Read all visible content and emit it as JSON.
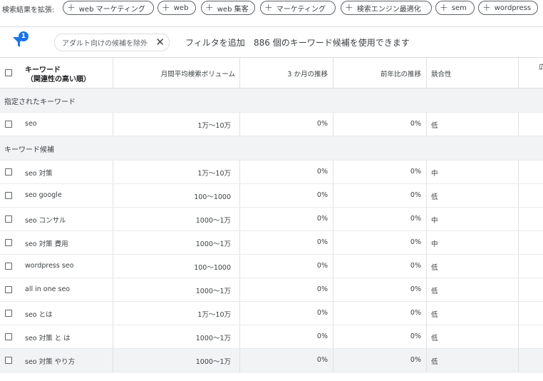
{
  "expand": {
    "label": "検索結果を拡張:",
    "chips": [
      "web マーケティング",
      "web",
      "web 集客",
      "マーケティング",
      "検索エンジン最適化",
      "sem",
      "wordpress"
    ]
  },
  "filter": {
    "badge": "1",
    "adult_chip": "アダルト向けの候補を除外",
    "add_filter": "フィルタを追加",
    "count_text": "886 個のキーワード候補を使用できます"
  },
  "table": {
    "headers": {
      "keyword_line1": "キーワード",
      "keyword_line2": "（関連性の高い順）",
      "volume": "月間平均検索ボリューム",
      "three_month": "3 か月の推移",
      "yoy": "前年比の推移",
      "competition": "競合性",
      "cut": "広"
    },
    "groups": {
      "specified": "指定されたキーワード",
      "candidates": "キーワード候補"
    },
    "specified_rows": [
      {
        "keyword": "seo",
        "volume": "1万～10万",
        "three_month": "0%",
        "yoy": "0%",
        "competition": "低"
      }
    ],
    "candidate_rows": [
      {
        "keyword": "seo 対策",
        "volume": "1万～10万",
        "three_month": "0%",
        "yoy": "0%",
        "competition": "中"
      },
      {
        "keyword": "seo google",
        "volume": "100～1000",
        "three_month": "0%",
        "yoy": "0%",
        "competition": "低"
      },
      {
        "keyword": "seo コンサル",
        "volume": "1000～1万",
        "three_month": "0%",
        "yoy": "0%",
        "competition": "中"
      },
      {
        "keyword": "seo 対策 費用",
        "volume": "1000～1万",
        "three_month": "0%",
        "yoy": "0%",
        "competition": "中"
      },
      {
        "keyword": "wordpress seo",
        "volume": "100～1000",
        "three_month": "0%",
        "yoy": "0%",
        "competition": "低"
      },
      {
        "keyword": "all in one seo",
        "volume": "1000～1万",
        "three_month": "0%",
        "yoy": "0%",
        "competition": "低"
      },
      {
        "keyword": "seo とは",
        "volume": "1万～10万",
        "three_month": "0%",
        "yoy": "0%",
        "competition": "低"
      },
      {
        "keyword": "seo 対策 と は",
        "volume": "1000～1万",
        "three_month": "0%",
        "yoy": "0%",
        "competition": "低"
      },
      {
        "keyword": "seo 対策 やり方",
        "volume": "1000～1万",
        "three_month": "0%",
        "yoy": "0%",
        "competition": "低"
      }
    ]
  },
  "colors": {
    "accent": "#1a73e8",
    "group_bg": "#f1f3f4",
    "border": "#dadce0"
  }
}
